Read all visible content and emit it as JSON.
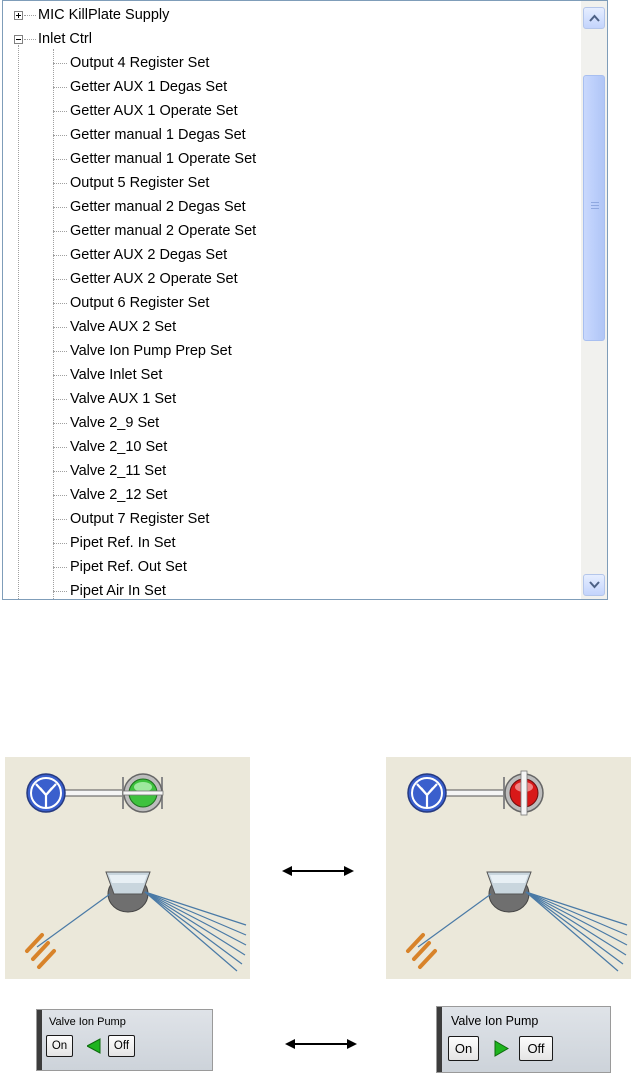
{
  "tree": {
    "top_nodes": [
      {
        "label": "MIC KillPlate Supply",
        "expanded": false
      },
      {
        "label": "Inlet Ctrl",
        "expanded": true
      }
    ],
    "children": [
      "Output 4 Register Set",
      "Getter AUX 1 Degas Set",
      "Getter AUX 1 Operate Set",
      "Getter manual 1 Degas Set",
      "Getter manual 1 Operate Set",
      "Output 5 Register Set",
      "Getter manual 2 Degas Set",
      "Getter manual 2 Operate Set",
      "Getter AUX 2 Degas Set",
      "Getter AUX 2 Operate Set",
      "Output 6 Register Set",
      "Valve AUX 2 Set",
      "Valve Ion Pump Prep Set",
      "Valve Inlet Set",
      "Valve AUX 1 Set",
      "Valve 2_9 Set",
      "Valve 2_10 Set",
      "Valve 2_11 Set",
      "Valve 2_12 Set",
      "Output 7 Register Set",
      "Pipet Ref. In Set",
      "Pipet Ref. Out Set",
      "Pipet Air In Set"
    ]
  },
  "diagrams": {
    "left_state": {
      "valve_color": "#3ec23e",
      "label": "open"
    },
    "right_state": {
      "valve_color": "#d81818",
      "label": "closed"
    }
  },
  "controls": {
    "left": {
      "title": "Valve Ion Pump",
      "on_label": "On",
      "off_label": "Off",
      "indicator": "arrow-left",
      "indicator_color": "#1eb41e"
    },
    "right": {
      "title": "Valve Ion Pump",
      "on_label": "On",
      "off_label": "Off",
      "indicator": "arrow-right",
      "indicator_color": "#1eb41e"
    }
  },
  "colors": {
    "panel_bg": "#ebe8da",
    "pump_blue": "#3a5fcd",
    "scroll_blue": "#c3d4fc"
  }
}
